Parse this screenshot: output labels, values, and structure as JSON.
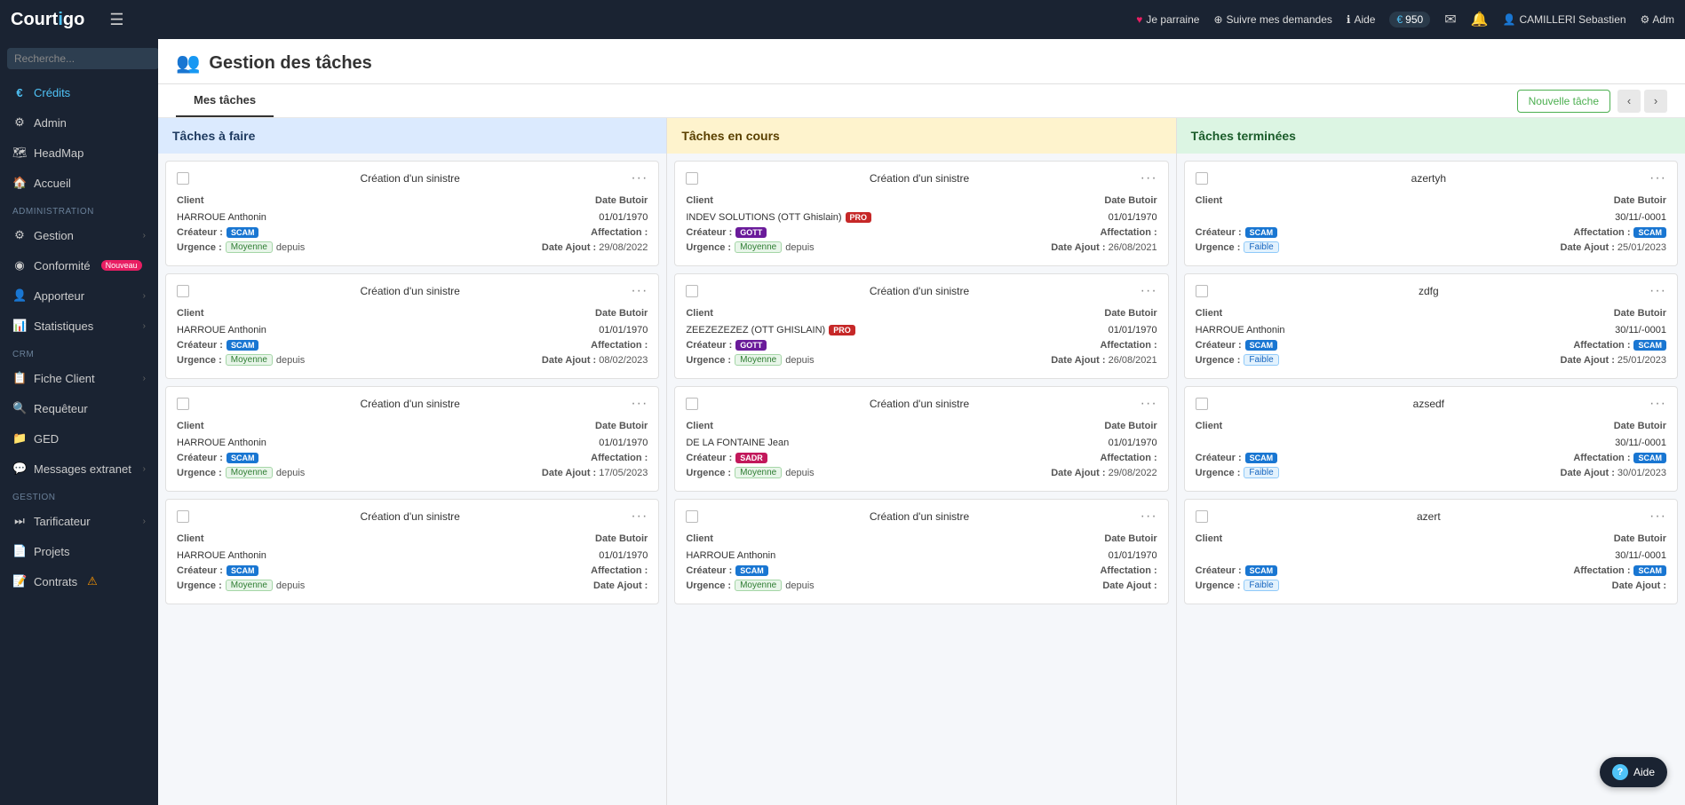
{
  "topnav": {
    "logo_text": "Courtigo",
    "hamburger_label": "☰",
    "parrainage_label": "Je parraine",
    "suivre_label": "Suivre mes demandes",
    "aide_label": "Aide",
    "credits_amount": "950",
    "user_name": "CAMILLERI Sebastien",
    "adm_label": "Adm"
  },
  "sidebar": {
    "search_placeholder": "Recherche...",
    "credits_label": "Crédits",
    "admin_label": "Admin",
    "headmap_label": "HeadMap",
    "accueil_label": "Accueil",
    "section_administration": "ADMINISTRATION",
    "gestion_label": "Gestion",
    "section_crm": "CRM",
    "conformite_label": "Conformité",
    "conformite_badge": "Nouveau",
    "apporteur_label": "Apporteur",
    "statistiques_label": "Statistiques",
    "fiche_client_label": "Fiche Client",
    "requeteur_label": "Requêteur",
    "ged_label": "GED",
    "messages_label": "Messages extranet",
    "section_gestion": "GESTION",
    "tarificateur_label": "Tarificateur",
    "projets_label": "Projets",
    "contrats_label": "Contrats"
  },
  "page": {
    "title": "Gestion des tâches",
    "tab_mes_taches": "Mes tâches",
    "btn_nouvelle_tache": "Nouvelle tâche"
  },
  "kanban": {
    "col_todo_title": "Tâches à faire",
    "col_inprogress_title": "Tâches en cours",
    "col_done_title": "Tâches terminées",
    "col_todo_cards": [
      {
        "title": "Création d'un sinistre",
        "client_label": "Client",
        "client_value": "HARROUE Anthonin",
        "date_butoir_label": "Date Butoir",
        "date_butoir_value": "01/01/1970",
        "createur_label": "Créateur :",
        "createur_badge": "SCAM",
        "createur_badge_type": "scam",
        "affectation_label": "Affectation :",
        "affectation_value": "",
        "urgence_label": "Urgence :",
        "urgence_value": "Moyenne",
        "urgence_type": "moyenne",
        "depuis_label": "depuis",
        "date_ajout_label": "Date Ajout :",
        "date_ajout_value": "29/08/2022"
      },
      {
        "title": "Création d'un sinistre",
        "client_label": "Client",
        "client_value": "HARROUE Anthonin",
        "date_butoir_label": "Date Butoir",
        "date_butoir_value": "01/01/1970",
        "createur_label": "Créateur :",
        "createur_badge": "SCAM",
        "createur_badge_type": "scam",
        "affectation_label": "Affectation :",
        "affectation_value": "",
        "urgence_label": "Urgence :",
        "urgence_value": "Moyenne",
        "urgence_type": "moyenne",
        "depuis_label": "depuis",
        "date_ajout_label": "Date Ajout :",
        "date_ajout_value": "08/02/2023"
      },
      {
        "title": "Création d'un sinistre",
        "client_label": "Client",
        "client_value": "HARROUE Anthonin",
        "date_butoir_label": "Date Butoir",
        "date_butoir_value": "01/01/1970",
        "createur_label": "Créateur :",
        "createur_badge": "SCAM",
        "createur_badge_type": "scam",
        "affectation_label": "Affectation :",
        "affectation_value": "",
        "urgence_label": "Urgence :",
        "urgence_value": "Moyenne",
        "urgence_type": "moyenne",
        "depuis_label": "depuis",
        "date_ajout_label": "Date Ajout :",
        "date_ajout_value": "17/05/2023"
      },
      {
        "title": "Création d'un sinistre",
        "client_label": "Client",
        "client_value": "HARROUE Anthonin",
        "date_butoir_label": "Date Butoir",
        "date_butoir_value": "01/01/1970",
        "createur_label": "Créateur :",
        "createur_badge": "SCAM",
        "createur_badge_type": "scam",
        "affectation_label": "Affectation :",
        "affectation_value": "",
        "urgence_label": "Urgence :",
        "urgence_value": "Moyenne",
        "urgence_type": "moyenne",
        "depuis_label": "depuis",
        "date_ajout_label": "Date Ajout :",
        "date_ajout_value": ""
      }
    ],
    "col_inprogress_cards": [
      {
        "title": "Création d'un sinistre",
        "client_label": "Client",
        "client_value": "INDEV SOLUTIONS (OTT Ghislain)",
        "client_badge": "PRO",
        "date_butoir_label": "Date Butoir",
        "date_butoir_value": "01/01/1970",
        "createur_label": "Créateur :",
        "createur_badge": "GOTT",
        "createur_badge_type": "gott",
        "affectation_label": "Affectation :",
        "affectation_value": "",
        "urgence_label": "Urgence :",
        "urgence_value": "Moyenne",
        "urgence_type": "moyenne",
        "depuis_label": "depuis",
        "date_ajout_label": "Date Ajout :",
        "date_ajout_value": "26/08/2021"
      },
      {
        "title": "Création d'un sinistre",
        "client_label": "Client",
        "client_value": "ZEEZEZEZEZ (OTT GHISLAIN)",
        "client_badge": "PRO",
        "date_butoir_label": "Date Butoir",
        "date_butoir_value": "01/01/1970",
        "createur_label": "Créateur :",
        "createur_badge": "GOTT",
        "createur_badge_type": "gott",
        "affectation_label": "Affectation :",
        "affectation_value": "",
        "urgence_label": "Urgence :",
        "urgence_value": "Moyenne",
        "urgence_type": "moyenne",
        "depuis_label": "depuis",
        "date_ajout_label": "Date Ajout :",
        "date_ajout_value": "26/08/2021"
      },
      {
        "title": "Création d'un sinistre",
        "client_label": "Client",
        "client_value": "DE LA FONTAINE Jean",
        "client_badge": "",
        "date_butoir_label": "Date Butoir",
        "date_butoir_value": "01/01/1970",
        "createur_label": "Créateur :",
        "createur_badge": "SADR",
        "createur_badge_type": "sadr",
        "affectation_label": "Affectation :",
        "affectation_value": "",
        "urgence_label": "Urgence :",
        "urgence_value": "Moyenne",
        "urgence_type": "moyenne",
        "depuis_label": "depuis",
        "date_ajout_label": "Date Ajout :",
        "date_ajout_value": "29/08/2022"
      },
      {
        "title": "Création d'un sinistre",
        "client_label": "Client",
        "client_value": "HARROUE Anthonin",
        "client_badge": "",
        "date_butoir_label": "Date Butoir",
        "date_butoir_value": "01/01/1970",
        "createur_label": "Créateur :",
        "createur_badge": "SCAM",
        "createur_badge_type": "scam",
        "affectation_label": "Affectation :",
        "affectation_value": "",
        "urgence_label": "Urgence :",
        "urgence_value": "Moyenne",
        "urgence_type": "moyenne",
        "depuis_label": "depuis",
        "date_ajout_label": "Date Ajout :",
        "date_ajout_value": ""
      }
    ],
    "col_done_cards": [
      {
        "title": "azertyh",
        "client_label": "Client",
        "client_value": "",
        "date_butoir_label": "Date Butoir",
        "date_butoir_value": "30/11/-0001",
        "createur_label": "Créateur :",
        "createur_badge": "SCAM",
        "createur_badge_type": "scam",
        "affectation_label": "Affectation :",
        "affectation_badge": "SCAM",
        "affectation_badge_type": "scam",
        "urgence_label": "Urgence :",
        "urgence_value": "Faible",
        "urgence_type": "faible",
        "depuis_label": "",
        "date_ajout_label": "Date Ajout :",
        "date_ajout_value": "25/01/2023"
      },
      {
        "title": "zdfg",
        "client_label": "Client",
        "client_value": "HARROUE Anthonin",
        "date_butoir_label": "Date Butoir",
        "date_butoir_value": "30/11/-0001",
        "createur_label": "Créateur :",
        "createur_badge": "SCAM",
        "createur_badge_type": "scam",
        "affectation_label": "Affectation :",
        "affectation_badge": "SCAM",
        "affectation_badge_type": "scam",
        "urgence_label": "Urgence :",
        "urgence_value": "Faible",
        "urgence_type": "faible",
        "depuis_label": "",
        "date_ajout_label": "Date Ajout :",
        "date_ajout_value": "25/01/2023"
      },
      {
        "title": "azsedf",
        "client_label": "Client",
        "client_value": "",
        "date_butoir_label": "Date Butoir",
        "date_butoir_value": "30/11/-0001",
        "createur_label": "Créateur :",
        "createur_badge": "SCAM",
        "createur_badge_type": "scam",
        "affectation_label": "Affectation :",
        "affectation_badge": "SCAM",
        "affectation_badge_type": "scam",
        "urgence_label": "Urgence :",
        "urgence_value": "Faible",
        "urgence_type": "faible",
        "depuis_label": "",
        "date_ajout_label": "Date Ajout :",
        "date_ajout_value": "30/01/2023"
      },
      {
        "title": "azert",
        "client_label": "Client",
        "client_value": "",
        "date_butoir_label": "Date Butoir",
        "date_butoir_value": "30/11/-0001",
        "createur_label": "Créateur :",
        "createur_badge": "SCAM",
        "createur_badge_type": "scam",
        "affectation_label": "Affectation :",
        "affectation_badge": "SCAM",
        "affectation_badge_type": "scam",
        "urgence_label": "Urgence :",
        "urgence_value": "Faible",
        "urgence_type": "faible",
        "depuis_label": "",
        "date_ajout_label": "Date Ajout :",
        "date_ajout_value": ""
      }
    ]
  },
  "help": {
    "label": "Aide"
  }
}
